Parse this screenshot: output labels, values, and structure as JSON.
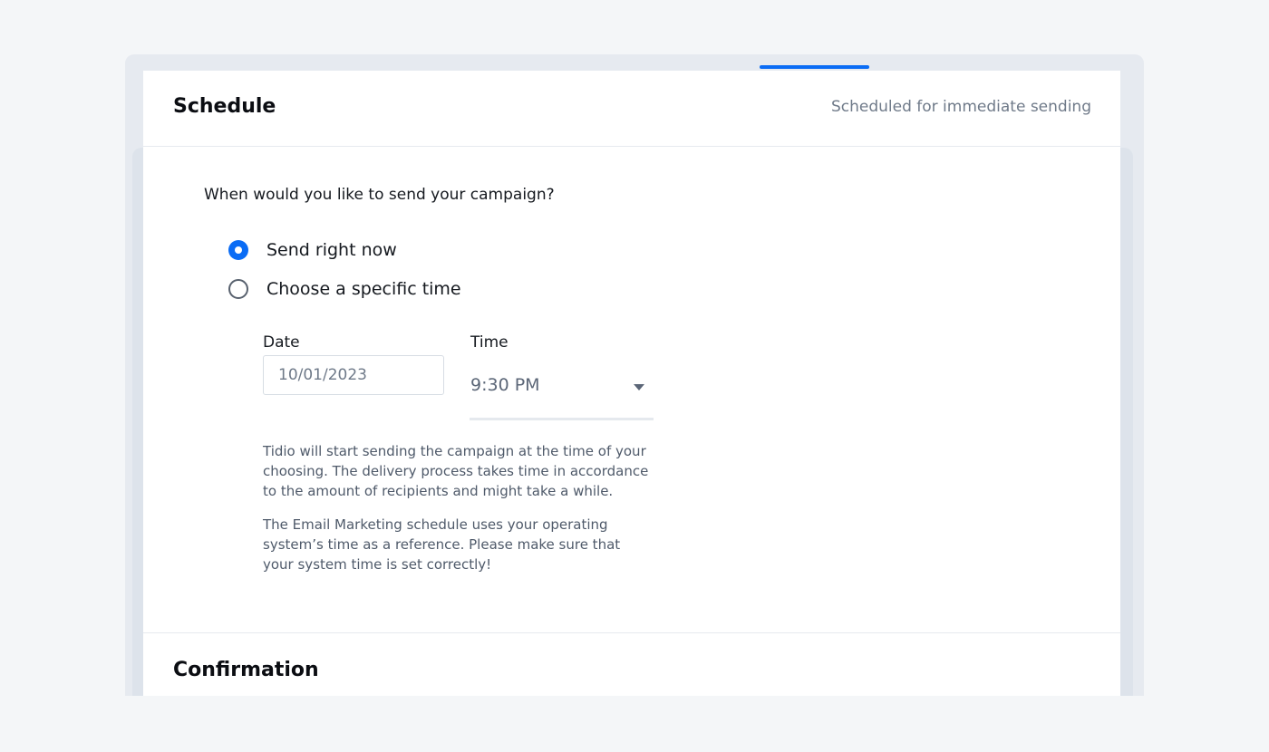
{
  "schedule": {
    "title": "Schedule",
    "status": "Scheduled for immediate sending",
    "question": "When would you like to send your campaign?",
    "options": [
      {
        "label": "Send right now",
        "checked": true
      },
      {
        "label": "Choose a specific time",
        "checked": false
      }
    ],
    "date": {
      "label": "Date",
      "value": "10/01/2023"
    },
    "time": {
      "label": "Time",
      "value": "9:30 PM"
    },
    "help": [
      "Tidio will start sending the campaign at the time of your choosing. The delivery process takes time in accordance to the amount of recipients and might take a while.",
      "The Email Marketing schedule uses your operating system’s time as a reference. Please make sure that your system time is set correctly!"
    ]
  },
  "confirmation": {
    "title": "Confirmation"
  },
  "colors": {
    "accent": "#0a6cf5",
    "background": "#f4f6f8",
    "card": "#ffffff"
  }
}
